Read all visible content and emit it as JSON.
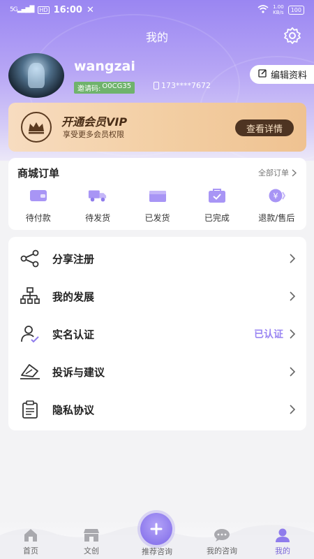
{
  "status_bar": {
    "network": "5G",
    "hd": "HD",
    "time": "16:00",
    "speed_top": "1.00",
    "speed_bottom": "KB/s",
    "battery": "100"
  },
  "header": {
    "title": "我的",
    "settings_icon": "gear-icon"
  },
  "profile": {
    "username": "wangzai",
    "invite_label": "邀请码:",
    "invite_code": "O0CG35",
    "phone": "173****7672",
    "edit_label": "编辑资料"
  },
  "vip": {
    "title": "开通会员VIP",
    "subtitle": "享受更多会员权限",
    "button": "查看详情"
  },
  "orders": {
    "title": "商城订单",
    "all_label": "全部订单",
    "items": [
      {
        "label": "待付款",
        "icon": "wallet-icon"
      },
      {
        "label": "待发货",
        "icon": "truck-icon"
      },
      {
        "label": "已发货",
        "icon": "box-icon"
      },
      {
        "label": "已完成",
        "icon": "check-bag-icon"
      },
      {
        "label": "退款/售后",
        "icon": "refund-icon"
      }
    ]
  },
  "menu": {
    "items": [
      {
        "label": "分享注册",
        "icon": "share-icon",
        "status": ""
      },
      {
        "label": "我的发展",
        "icon": "org-chart-icon",
        "status": ""
      },
      {
        "label": "实名认证",
        "icon": "user-verify-icon",
        "status": "已认证"
      },
      {
        "label": "投诉与建议",
        "icon": "feedback-icon",
        "status": ""
      },
      {
        "label": "隐私协议",
        "icon": "clipboard-icon",
        "status": ""
      }
    ]
  },
  "nav": {
    "items": [
      {
        "label": "首页",
        "icon": "home-icon"
      },
      {
        "label": "文创",
        "icon": "shop-icon"
      },
      {
        "label": "推荐咨询",
        "icon": "plus-icon"
      },
      {
        "label": "我的咨询",
        "icon": "chat-icon"
      },
      {
        "label": "我的",
        "icon": "user-icon"
      }
    ],
    "active_color": "#7a67d8"
  },
  "colors": {
    "accent": "#9a86f2",
    "vip_dark": "#4e3422",
    "invite_green": "#6fb36c"
  }
}
